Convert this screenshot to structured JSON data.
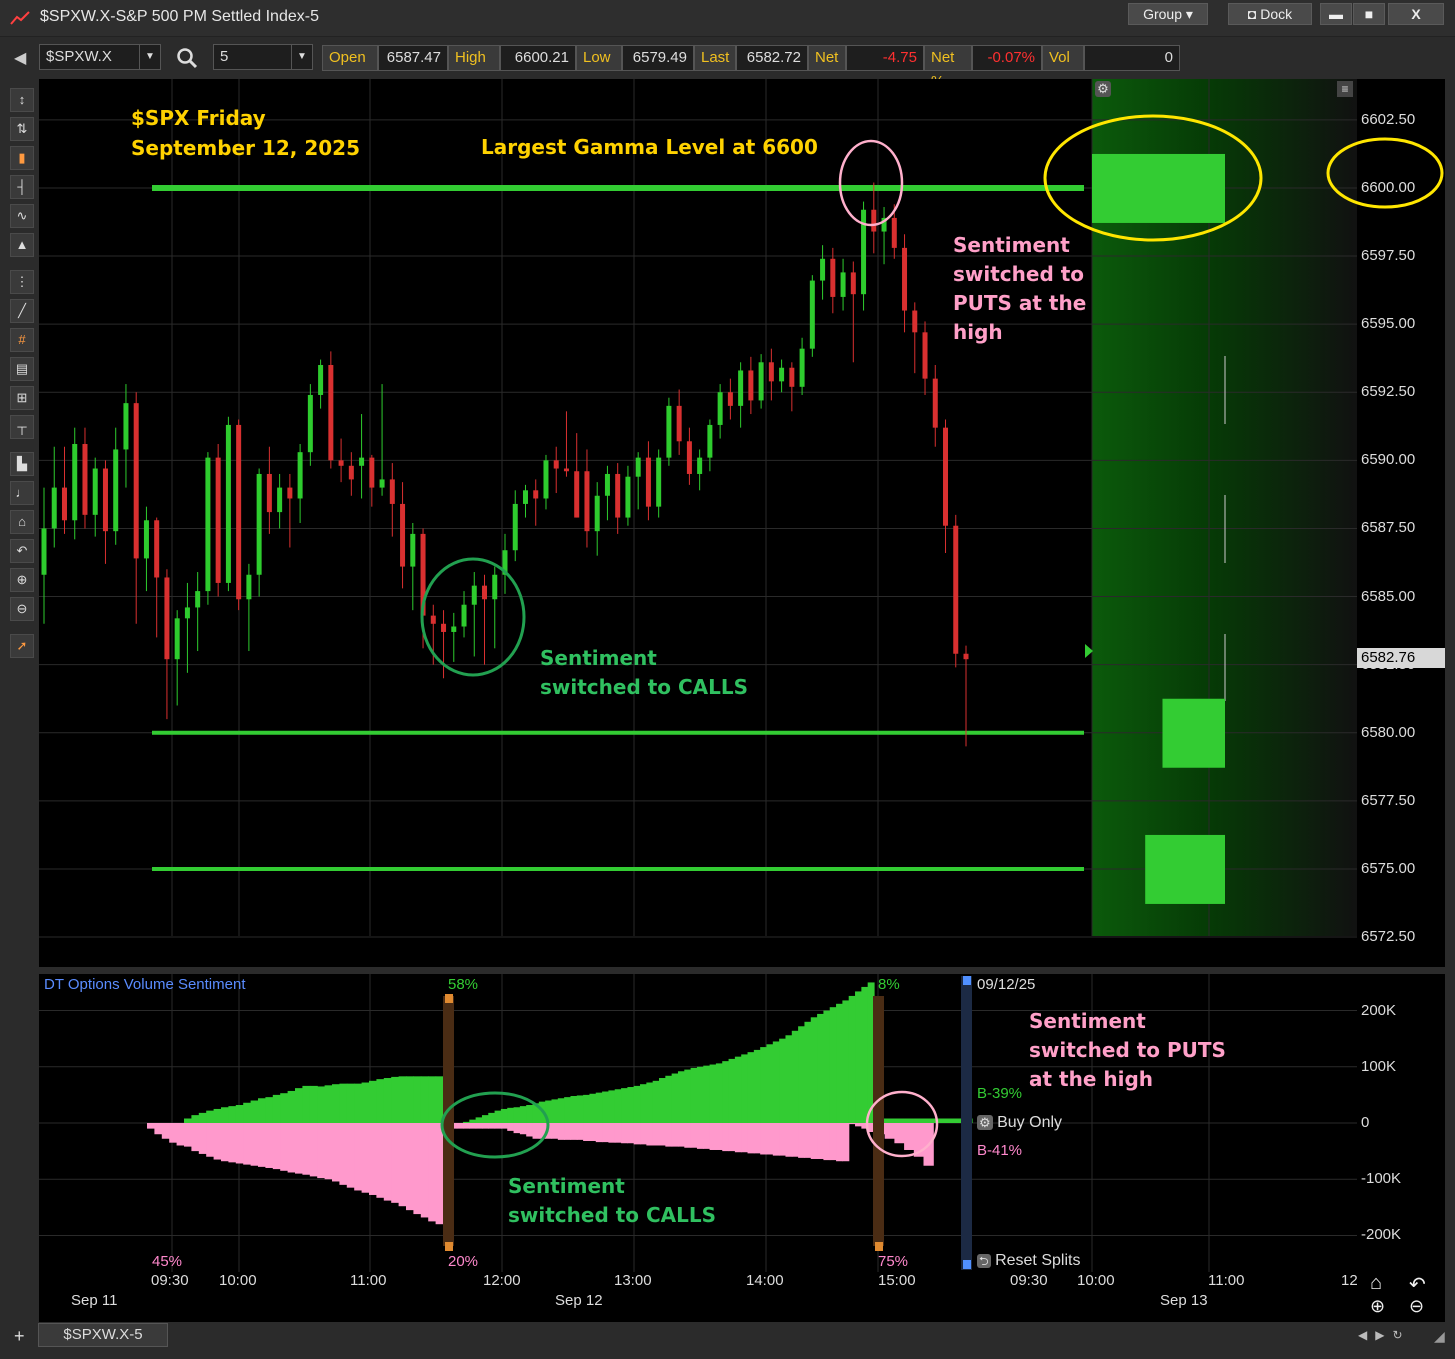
{
  "window": {
    "title": "$SPXW.X-S&P 500 PM Settled Index-5",
    "group_label": "Group",
    "dock_label": "Dock",
    "minimize": "▬",
    "maximize": "■",
    "close": "X"
  },
  "toolbar": {
    "symbol": "$SPXW.X",
    "interval": "5",
    "quote": [
      {
        "label": "Open",
        "value": "6587.47",
        "color": "#dddddd"
      },
      {
        "label": "High",
        "value": "6600.21",
        "color": "#dddddd"
      },
      {
        "label": "Low",
        "value": "6579.49",
        "color": "#dddddd"
      },
      {
        "label": "Last",
        "value": "6582.72",
        "color": "#dddddd"
      },
      {
        "label": "Net",
        "value": "-4.75",
        "color": "#ff3030"
      },
      {
        "label": "Net %",
        "value": "-0.07%",
        "color": "#ff3030"
      },
      {
        "label": "Vol",
        "value": "0",
        "color": "#dddddd"
      }
    ]
  },
  "annotations": {
    "title_line1": "$SPX Friday",
    "title_line2": "September 12, 2025",
    "gamma": "Largest Gamma Level at 6600",
    "puts_1": "Sentiment",
    "puts_2": "switched to",
    "puts_3": "PUTS at the",
    "puts_4": "high",
    "calls_1": "Sentiment",
    "calls_2": "switched to CALLS",
    "sub_puts_1": "Sentiment",
    "sub_puts_2": "switched to PUTS",
    "sub_puts_3": "at the high",
    "sub_calls_1": "Sentiment",
    "sub_calls_2": "switched to CALLS"
  },
  "chart_data": [
    {
      "type": "candlestick",
      "price_axis": [
        "6602.50",
        "6600.00",
        "6597.50",
        "6595.00",
        "6592.50",
        "6590.00",
        "6587.50",
        "6585.00",
        "6582.50",
        "6580.00",
        "6577.50",
        "6575.00",
        "6572.50"
      ],
      "ylim": [
        6571.4,
        6604.0
      ],
      "last_price_label": "6582.76",
      "last_price": 6582.76,
      "gamma_levels": [
        6600.0,
        6580.0,
        6575.0
      ],
      "gamma_bars": [
        {
          "price": 6600.0,
          "strength": 1.0
        },
        {
          "price": 6580.0,
          "strength": 0.47
        },
        {
          "price": 6575.0,
          "strength": 0.6
        }
      ],
      "candles": [
        [
          6585.8,
          6589.0,
          6584.0,
          6587.5
        ],
        [
          6587.5,
          6590.5,
          6586.8,
          6589.0
        ],
        [
          6589.0,
          6590.5,
          6587.3,
          6587.8
        ],
        [
          6587.8,
          6591.2,
          6587.1,
          6590.6
        ],
        [
          6590.6,
          6591.2,
          6587.5,
          6588.0
        ],
        [
          6588.0,
          6590.1,
          6587.2,
          6589.7
        ],
        [
          6589.7,
          6590.0,
          6586.2,
          6587.4
        ],
        [
          6587.4,
          6591.2,
          6586.9,
          6590.4
        ],
        [
          6590.4,
          6592.8,
          6589.0,
          6592.1
        ],
        [
          6592.1,
          6592.5,
          6584.0,
          6586.4
        ],
        [
          6586.4,
          6588.3,
          6585.2,
          6587.8
        ],
        [
          6587.8,
          6587.9,
          6583.5,
          6585.7
        ],
        [
          6585.7,
          6586.0,
          6580.5,
          6582.7
        ],
        [
          6582.7,
          6584.5,
          6581.0,
          6584.2
        ],
        [
          6584.2,
          6585.5,
          6582.2,
          6584.6
        ],
        [
          6584.6,
          6585.9,
          6583.0,
          6585.2
        ],
        [
          6585.2,
          6590.3,
          6584.7,
          6590.1
        ],
        [
          6590.1,
          6590.6,
          6585.0,
          6585.5
        ],
        [
          6585.5,
          6591.6,
          6585.2,
          6591.3
        ],
        [
          6591.3,
          6591.5,
          6584.5,
          6584.9
        ],
        [
          6584.9,
          6586.2,
          6583.0,
          6585.8
        ],
        [
          6585.8,
          6589.7,
          6585.0,
          6589.5
        ],
        [
          6589.5,
          6590.5,
          6587.3,
          6588.1
        ],
        [
          6588.1,
          6589.5,
          6587.5,
          6589.0
        ],
        [
          6589.0,
          6589.5,
          6586.8,
          6588.6
        ],
        [
          6588.6,
          6590.6,
          6587.7,
          6590.3
        ],
        [
          6590.3,
          6592.8,
          6589.8,
          6592.4
        ],
        [
          6592.4,
          6593.7,
          6591.9,
          6593.5
        ],
        [
          6593.5,
          6594.0,
          6589.7,
          6590.0
        ],
        [
          6590.0,
          6590.8,
          6589.2,
          6589.8
        ],
        [
          6589.8,
          6590.3,
          6588.7,
          6589.3
        ],
        [
          6589.8,
          6591.7,
          6588.6,
          6590.1
        ],
        [
          6590.1,
          6590.2,
          6588.3,
          6589.0
        ],
        [
          6589.0,
          6592.8,
          6588.7,
          6589.3
        ],
        [
          6589.3,
          6589.9,
          6587.2,
          6588.4
        ],
        [
          6588.4,
          6589.2,
          6585.3,
          6586.1
        ],
        [
          6586.1,
          6587.7,
          6584.5,
          6587.3
        ],
        [
          6587.3,
          6587.5,
          6583.1,
          6584.3
        ],
        [
          6584.3,
          6584.7,
          6582.5,
          6584.0
        ],
        [
          6584.0,
          6584.5,
          6582.0,
          6583.7
        ],
        [
          6583.7,
          6584.4,
          6582.6,
          6583.9
        ],
        [
          6583.9,
          6585.2,
          6583.5,
          6584.7
        ],
        [
          6584.7,
          6585.9,
          6582.8,
          6585.4
        ],
        [
          6585.4,
          6585.8,
          6582.5,
          6584.9
        ],
        [
          6584.9,
          6586.1,
          6583.1,
          6585.8
        ],
        [
          6585.8,
          6587.3,
          6585.1,
          6586.7
        ],
        [
          6586.7,
          6588.9,
          6586.3,
          6588.4
        ],
        [
          6588.4,
          6589.1,
          6587.9,
          6588.9
        ],
        [
          6588.9,
          6589.3,
          6587.6,
          6588.6
        ],
        [
          6588.6,
          6590.2,
          6588.2,
          6590.0
        ],
        [
          6590.0,
          6590.5,
          6588.8,
          6589.7
        ],
        [
          6589.7,
          6591.8,
          6589.4,
          6589.6
        ],
        [
          6589.6,
          6591.0,
          6587.9,
          6587.9
        ],
        [
          6589.6,
          6590.4,
          6586.8,
          6587.4
        ],
        [
          6587.4,
          6589.2,
          6586.5,
          6588.7
        ],
        [
          6588.7,
          6589.8,
          6587.8,
          6589.5
        ],
        [
          6589.5,
          6589.9,
          6587.3,
          6587.9
        ],
        [
          6587.9,
          6589.8,
          6587.6,
          6589.4
        ],
        [
          6589.4,
          6590.3,
          6588.2,
          6590.1
        ],
        [
          6590.1,
          6590.7,
          6587.8,
          6588.3
        ],
        [
          6588.3,
          6590.4,
          6587.9,
          6590.1
        ],
        [
          6590.1,
          6592.3,
          6589.8,
          6592.0
        ],
        [
          6592.0,
          6592.6,
          6590.2,
          6590.7
        ],
        [
          6590.7,
          6591.2,
          6589.1,
          6589.5
        ],
        [
          6589.5,
          6590.4,
          6588.9,
          6590.1
        ],
        [
          6590.1,
          6591.5,
          6589.6,
          6591.3
        ],
        [
          6591.3,
          6592.8,
          6590.8,
          6592.5
        ],
        [
          6592.5,
          6593.0,
          6591.5,
          6592.0
        ],
        [
          6592.0,
          6593.6,
          6591.2,
          6593.3
        ],
        [
          6593.3,
          6593.8,
          6591.7,
          6592.2
        ],
        [
          6592.2,
          6593.9,
          6591.9,
          6593.6
        ],
        [
          6593.6,
          6594.1,
          6592.2,
          6592.9
        ],
        [
          6592.9,
          6593.7,
          6592.5,
          6593.4
        ],
        [
          6593.4,
          6593.6,
          6591.8,
          6592.7
        ],
        [
          6592.7,
          6594.5,
          6592.4,
          6594.1
        ],
        [
          6594.1,
          6596.8,
          6593.8,
          6596.6
        ],
        [
          6596.6,
          6597.9,
          6595.9,
          6597.4
        ],
        [
          6597.4,
          6597.8,
          6595.4,
          6596.0
        ],
        [
          6596.0,
          6597.4,
          6595.5,
          6596.9
        ],
        [
          6596.9,
          6597.3,
          6593.6,
          6596.1
        ],
        [
          6596.1,
          6599.5,
          6595.5,
          6599.2
        ],
        [
          6599.2,
          6600.2,
          6597.6,
          6598.4
        ],
        [
          6598.4,
          6599.3,
          6597.2,
          6598.9
        ],
        [
          6598.9,
          6599.4,
          6597.4,
          6597.8
        ],
        [
          6597.8,
          6598.3,
          6594.7,
          6595.5
        ],
        [
          6595.5,
          6595.8,
          6593.2,
          6594.7
        ],
        [
          6594.7,
          6595.1,
          6592.4,
          6593.0
        ],
        [
          6593.0,
          6593.5,
          6590.5,
          6591.2
        ],
        [
          6591.2,
          6591.5,
          6586.6,
          6587.6
        ],
        [
          6587.6,
          6588.0,
          6582.4,
          6582.9
        ],
        [
          6582.9,
          6583.2,
          6579.5,
          6582.7
        ]
      ],
      "colors": {
        "up": "#2ecc2e",
        "down": "#d93030",
        "gamma": "#33cc33"
      }
    },
    {
      "type": "area",
      "title": "DT Options Volume Sentiment",
      "value_axis": [
        "200K",
        "100K",
        "0",
        "-100K",
        "-200K"
      ],
      "ylim": [
        -265,
        265
      ],
      "call_volume_k": [
        0,
        0,
        0,
        0,
        0,
        8,
        14,
        18,
        22,
        25,
        28,
        30,
        32,
        36,
        40,
        44,
        46,
        50,
        53,
        57,
        62,
        66,
        66,
        65,
        67,
        69,
        70,
        70,
        70,
        72,
        75,
        78,
        80,
        82,
        83,
        83,
        83,
        83,
        83,
        83,
        0,
        0,
        0,
        2,
        6,
        10,
        14,
        18,
        22,
        25,
        27,
        28,
        30,
        32,
        35,
        38,
        40,
        42,
        44,
        46,
        48,
        49,
        50,
        52,
        54,
        56,
        58,
        60,
        62,
        64,
        66,
        69,
        72,
        75,
        80,
        84,
        88,
        92,
        95,
        98,
        100,
        102,
        104,
        106,
        110,
        114,
        118,
        122,
        126,
        130,
        135,
        140,
        145,
        150,
        156,
        164,
        172,
        180,
        188,
        194,
        200,
        206,
        212,
        218,
        226,
        234,
        242,
        250,
        8,
        8,
        8,
        8,
        8,
        8,
        8,
        8,
        8,
        8
      ],
      "put_volume_k": [
        -10,
        -20,
        -28,
        -35,
        -40,
        -42,
        -50,
        -55,
        -60,
        -65,
        -68,
        -70,
        -72,
        -74,
        -76,
        -78,
        -80,
        -82,
        -85,
        -88,
        -90,
        -92,
        -95,
        -98,
        -100,
        -104,
        -110,
        -115,
        -120,
        -124,
        -128,
        -133,
        -138,
        -142,
        -148,
        -155,
        -162,
        -168,
        -175,
        -180,
        -8,
        -10,
        -10,
        -10,
        -10,
        -10,
        -10,
        -10,
        -10,
        -10,
        -14,
        -18,
        -20,
        -24,
        -28,
        -28,
        -28,
        -28,
        -30,
        -30,
        -30,
        -30,
        -32,
        -32,
        -34,
        -34,
        -35,
        -35,
        -36,
        -36,
        -38,
        -38,
        -40,
        -40,
        -40,
        -42,
        -42,
        -42,
        -44,
        -44,
        -46,
        -46,
        -48,
        -48,
        -50,
        -50,
        -52,
        -52,
        -54,
        -54,
        -56,
        -56,
        -58,
        -58,
        -60,
        -60,
        -62,
        -62,
        -64,
        -64,
        -66,
        -66,
        -68,
        -68,
        -2,
        -6,
        -10,
        -16,
        -20,
        -28,
        -36,
        -48,
        -60,
        -76
      ],
      "pct_labels": {
        "top_left": "58%",
        "bottom_left_start": "45%",
        "bottom_split1": "20%",
        "top_split2": "8%",
        "bottom_split2": "75%"
      },
      "right_labels": {
        "date": "09/12/25",
        "buy_pct": "B-39%",
        "buy_only": "Buy Only",
        "sell_pct": "B-41%",
        "reset": "Reset Splits"
      },
      "colors": {
        "calls": "#33cc33",
        "puts": "#ff99cc"
      }
    }
  ],
  "time_axis": {
    "ticks": [
      "09:30",
      "10:00",
      "11:00",
      "12:00",
      "13:00",
      "14:00",
      "15:00",
      "09:30",
      "10:00",
      "11:00",
      "12"
    ],
    "days": [
      "Sep 11",
      "Sep 12",
      "Sep 13"
    ]
  },
  "status": {
    "tab": "$SPXW.X-5",
    "add": "+"
  }
}
